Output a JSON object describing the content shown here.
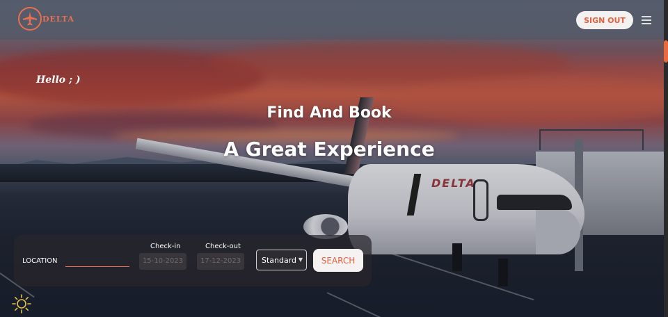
{
  "header": {
    "logo_text": "DELTA",
    "signout_label": "SIGN OUT",
    "logo_icon": "airplane-icon",
    "menu_icon": "hamburger-menu-icon"
  },
  "hero": {
    "greeting": "Hello ; )",
    "headline_line1": "Find And Book",
    "headline_line2": "A Great Experience",
    "plane_livery": "DELTA"
  },
  "search": {
    "location_label": "LOCATION",
    "location_value": "",
    "checkin_label": "Check-in",
    "checkin_value": "15-10-2023",
    "checkout_label": "Check-out",
    "checkout_value": "17-12-2023",
    "class_selected": "Standard",
    "search_label": "SEARCH"
  },
  "theme_toggle_icon": "sun-icon",
  "colors": {
    "accent": "#e8603c",
    "search_bar_bg": "#28262c",
    "button_bg": "#f6f2f2"
  }
}
